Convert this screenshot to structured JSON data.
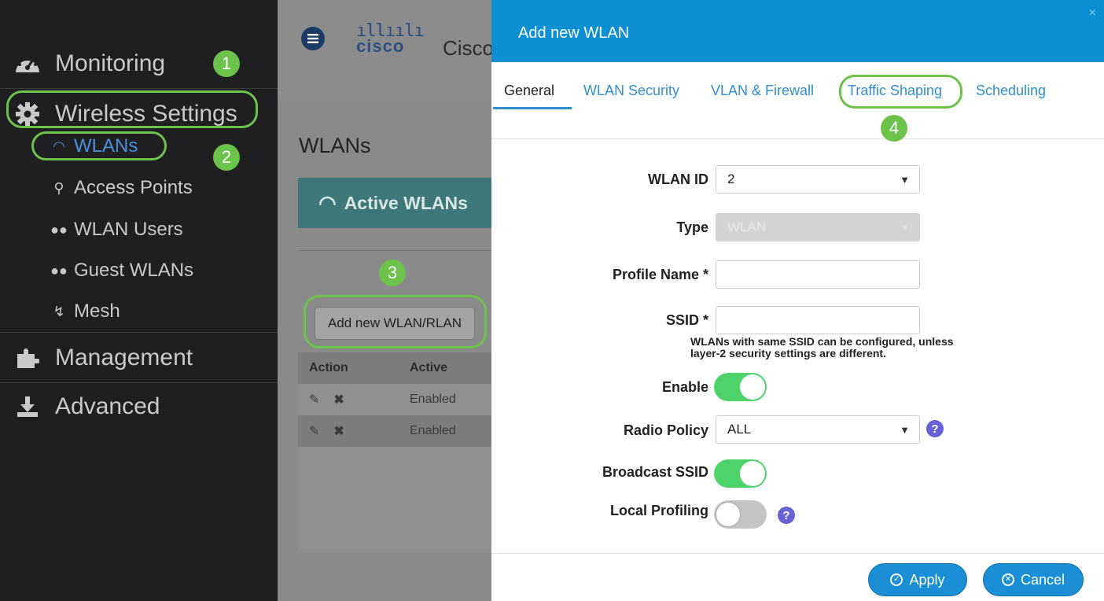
{
  "sidebar": {
    "items": [
      {
        "label": "Monitoring",
        "icon": "dashboard-icon"
      },
      {
        "label": "Wireless Settings",
        "icon": "gear-icon"
      },
      {
        "label": "Management",
        "icon": "puzzle-icon"
      },
      {
        "label": "Advanced",
        "icon": "download-icon"
      }
    ],
    "subitems": [
      {
        "label": "WLANs",
        "icon": "wifi-icon",
        "active": true
      },
      {
        "label": "Access Points",
        "icon": "access-point-icon"
      },
      {
        "label": "WLAN Users",
        "icon": "users-icon"
      },
      {
        "label": "Guest WLANs",
        "icon": "users-icon"
      },
      {
        "label": "Mesh",
        "icon": "bolt-icon"
      }
    ]
  },
  "callouts": {
    "one": "1",
    "two": "2",
    "three": "3",
    "four": "4",
    "color": "#6cc24a"
  },
  "header": {
    "brand_bars": "ıllıılı",
    "brand_word": "cisco",
    "title": "Cisco"
  },
  "page": {
    "title": "WLANs",
    "active_wlans": "Active WLANs",
    "add_button": "Add new WLAN/RLAN",
    "table": {
      "headers": [
        "Action",
        "Active"
      ],
      "rows": [
        {
          "active": "Enabled"
        },
        {
          "active": "Enabled"
        }
      ]
    }
  },
  "modal": {
    "title": "Add new WLAN",
    "close": "×",
    "tabs": [
      "General",
      "WLAN Security",
      "VLAN & Firewall",
      "Traffic Shaping",
      "Scheduling"
    ],
    "fields": {
      "wlan_id_label": "WLAN ID",
      "wlan_id_value": "2",
      "type_label": "Type",
      "type_value": "WLAN",
      "profile_label": "Profile Name *",
      "profile_value": "",
      "ssid_label": "SSID *",
      "ssid_value": "",
      "ssid_hint_1": "WLANs with same SSID can be configured, unless",
      "ssid_hint_2": "layer-2 security settings are different.",
      "enable_label": "Enable",
      "enable_on": true,
      "radio_label": "Radio Policy",
      "radio_value": "ALL",
      "broadcast_label": "Broadcast SSID",
      "broadcast_on": true,
      "local_label": "Local Profiling",
      "local_on": false
    },
    "apply": "Apply",
    "cancel": "Cancel",
    "accent": "#0d8fd4",
    "toggle_on_color": "#4ed36a"
  }
}
